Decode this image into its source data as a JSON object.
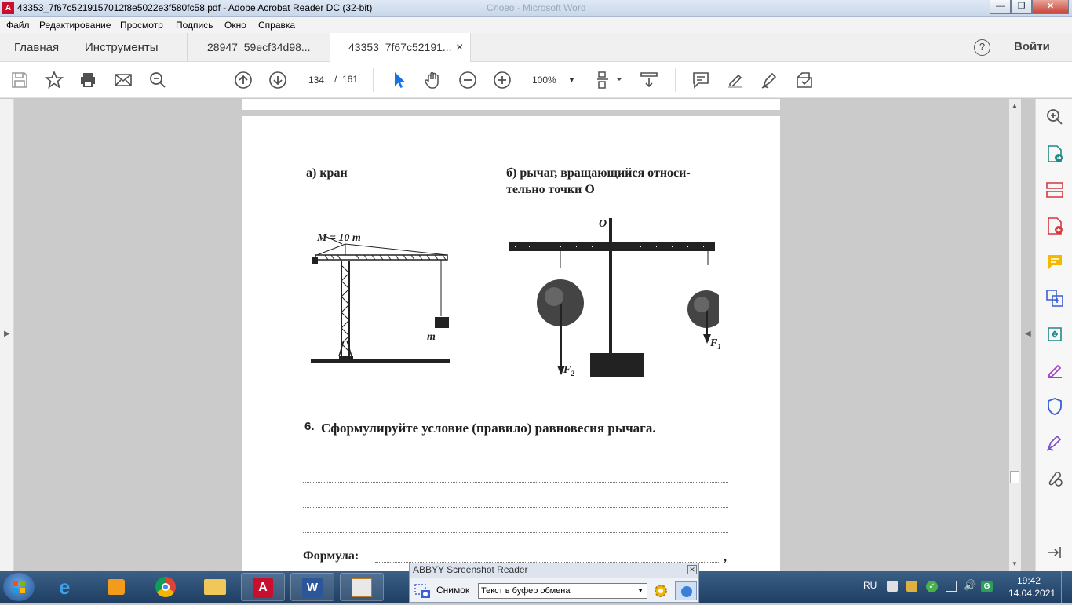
{
  "window": {
    "title": "43353_7f67c5219157012f8e5022e3f580fc58.pdf - Adobe Acrobat Reader DC (32-bit)",
    "bg_title": "Слово - Microsoft Word"
  },
  "menu": [
    "Файл",
    "Редактирование",
    "Просмотр",
    "Подпись",
    "Окно",
    "Справка"
  ],
  "tabs": {
    "home": "Главная",
    "tools": "Инструменты",
    "doc1": "28947_59ecf34d98...",
    "doc2": "43353_7f67c52191...",
    "close": "×",
    "help": "?",
    "signin": "Войти"
  },
  "toolbar": {
    "page_current": "134",
    "page_sep": "/",
    "page_total": "161",
    "zoom": "100%"
  },
  "document": {
    "label_a": "а) кран",
    "label_b_line1": "б) рычаг, вращающийся относи-",
    "label_b_line2": "тельно точки O",
    "crane_mass": "M = 10 т",
    "crane_load": "m",
    "lever_point": "O",
    "force1": "F",
    "force1_sub": "1",
    "force2": "F",
    "force2_sub": "2",
    "q_number": "6.",
    "q_text": "Сформулируйте условие (правило) равновесия рычага.",
    "formula_label": "Формула:",
    "formula_comma": ","
  },
  "abbyy": {
    "title": "ABBYY Screenshot Reader",
    "snap_label": "Снимок",
    "mode": "Текст в буфер обмена"
  },
  "tray": {
    "lang": "RU",
    "time": "19:42",
    "date": "14.04.2021"
  }
}
